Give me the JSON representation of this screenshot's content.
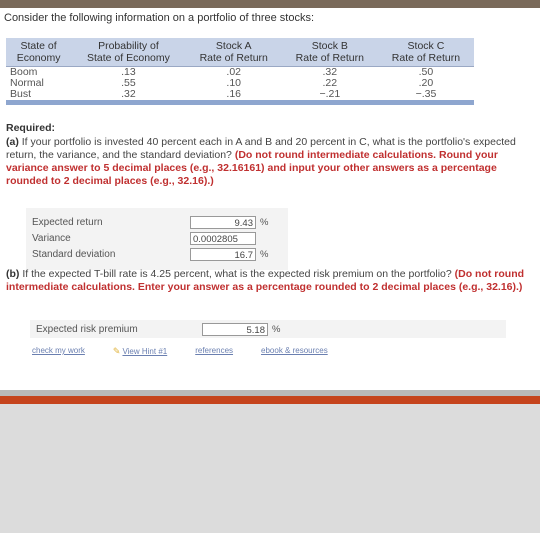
{
  "intro": "Consider the following information on a portfolio of three stocks:",
  "table": {
    "headers": [
      {
        "line1": "State of",
        "line2": "Economy"
      },
      {
        "line1": "Probability of",
        "line2": "State of Economy"
      },
      {
        "line1": "Stock A",
        "line2": "Rate of Return"
      },
      {
        "line1": "Stock B",
        "line2": "Rate of Return"
      },
      {
        "line1": "Stock C",
        "line2": "Rate of Return"
      }
    ],
    "rows": [
      {
        "state": "Boom",
        "prob": ".13",
        "a": ".02",
        "b": ".32",
        "c": ".50"
      },
      {
        "state": "Normal",
        "prob": ".55",
        "a": ".10",
        "b": ".22",
        "c": ".20"
      },
      {
        "state": "Bust",
        "prob": ".32",
        "a": ".16",
        "b": "−.21",
        "c": "−.35"
      }
    ]
  },
  "required": "Required:",
  "part_a": {
    "label": "(a)",
    "text": "If your portfolio is invested 40 percent each in A and B and 20 percent in C, what is the portfolio's expected return, the variance, and the standard deviation?",
    "instruction": "(Do not round intermediate calculations. Round your variance answer to 5 decimal places (e.g., 32.16161) and input your other answers as a percentage rounded to 2 decimal places (e.g., 32.16).)"
  },
  "answers": {
    "expected_return_label": "Expected return",
    "expected_return_value": "9.43",
    "variance_label": "Variance",
    "variance_value": "0.0002805",
    "std_label": "Standard deviation",
    "std_value": "16.7",
    "percent": "%"
  },
  "part_b": {
    "label": "(b)",
    "text": "If the expected T-bill rate is 4.25 percent, what is the expected risk premium on the portfolio?",
    "instruction": "(Do not round intermediate calculations. Enter your answer as a percentage rounded to 2 decimal places (e.g., 32.16).)"
  },
  "premium": {
    "label": "Expected risk premium",
    "value": "5.18",
    "percent": "%"
  },
  "links": {
    "check": "check my work",
    "hint": "View Hint #1",
    "references": "references",
    "ebook": "ebook & resources"
  }
}
